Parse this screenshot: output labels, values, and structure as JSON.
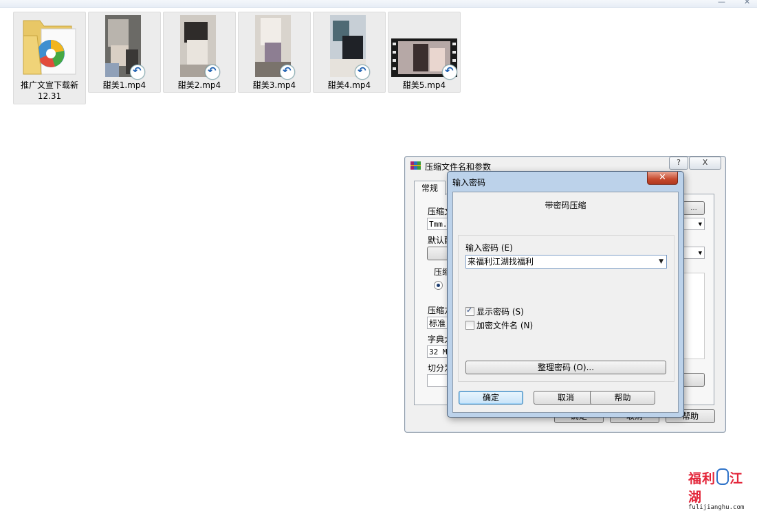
{
  "files": [
    {
      "name": "推广文宣下载新",
      "name2": "12.31",
      "type": "folder"
    },
    {
      "name": "甜美1.mp4",
      "type": "video"
    },
    {
      "name": "甜美2.mp4",
      "type": "video"
    },
    {
      "name": "甜美3.mp4",
      "type": "video"
    },
    {
      "name": "甜美4.mp4",
      "type": "video"
    },
    {
      "name": "甜美5.mp4",
      "type": "video"
    }
  ],
  "back_dialog": {
    "title": "压缩文件名和参数",
    "help_btn": "?",
    "close_btn": "X",
    "tab_general": "常规",
    "frag_archive": "压缩文",
    "frag_archive_value": "Tmm.:",
    "frag_default": "默认配",
    "frag_method": "压缩",
    "frag_format": "压缩方",
    "frag_format_value": "标准",
    "frag_dict": "字典大",
    "frag_dict_value": "32 M",
    "frag_split": "切分为",
    "btn_browse": "...",
    "btn_ok": "确定",
    "btn_cancel": "取消",
    "btn_help": "帮助"
  },
  "password_dialog": {
    "title": "输入密码",
    "subtitle": "带密码压缩",
    "password_label": "输入密码 (E)",
    "password_value": "来福利江湖找福利",
    "show_password_label": "显示密码 (S)",
    "show_password_checked": true,
    "encrypt_names_label": "加密文件名 (N)",
    "encrypt_names_checked": false,
    "organize_button": "整理密码 (O)...",
    "ok_button": "确定",
    "cancel_button": "取消",
    "help_button": "帮助"
  },
  "watermark": {
    "logo_text": "福利江湖",
    "url": "fulijianghu.com",
    "color": "#e3263a"
  }
}
